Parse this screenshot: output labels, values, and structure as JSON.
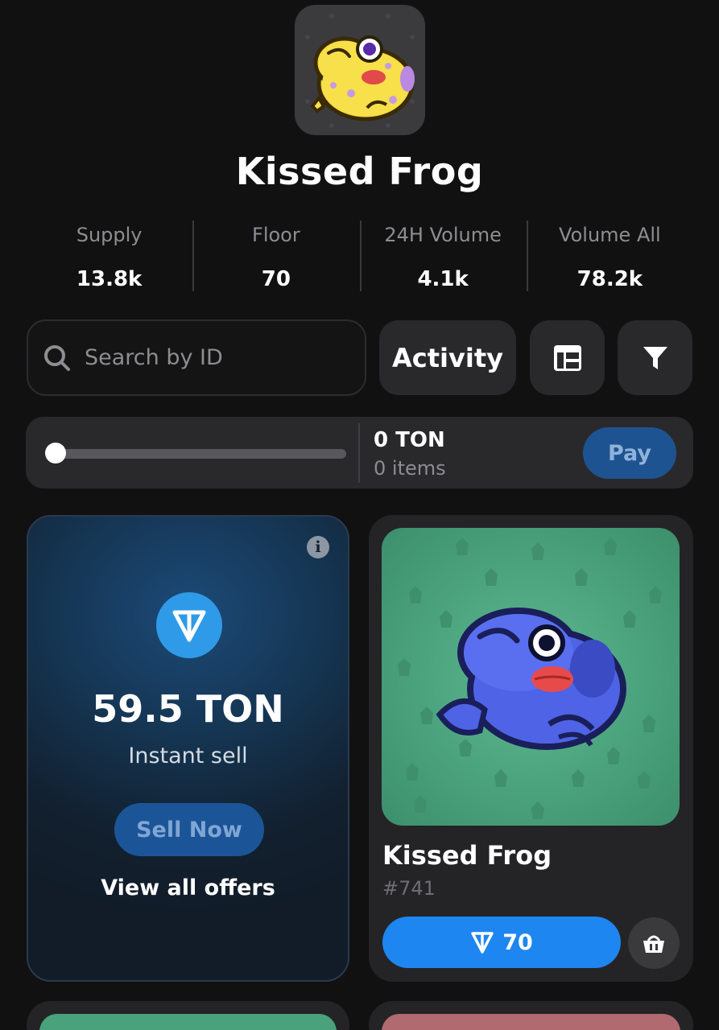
{
  "collection": {
    "title": "Kissed Frog",
    "avatar_icon": "frog-icon"
  },
  "stats": [
    {
      "label": "Supply",
      "value": "13.8k"
    },
    {
      "label": "Floor",
      "value": "70"
    },
    {
      "label": "24H Volume",
      "value": "4.1k"
    },
    {
      "label": "Volume All",
      "value": "78.2k"
    }
  ],
  "toolbar": {
    "search_placeholder": "Search by ID",
    "activity_label": "Activity",
    "view_icon": "layout-icon",
    "filter_icon": "filter-icon"
  },
  "cart": {
    "slider_value": 0,
    "total": "0 TON",
    "items": "0 items",
    "pay_label": "Pay"
  },
  "sell_card": {
    "amount": "59.5 TON",
    "caption": "Instant sell",
    "sell_button": "Sell Now",
    "offers_link": "View all offers",
    "info_glyph": "i"
  },
  "gift": {
    "name": "Kissed Frog",
    "number": "#741",
    "price": "70",
    "background_color": "#4aa27d",
    "frog_color": "#4a5de0"
  },
  "colors": {
    "background": "#111112",
    "card": "#242427",
    "accent_blue": "#1e86f0",
    "ton_blue": "#2f9ae8"
  }
}
